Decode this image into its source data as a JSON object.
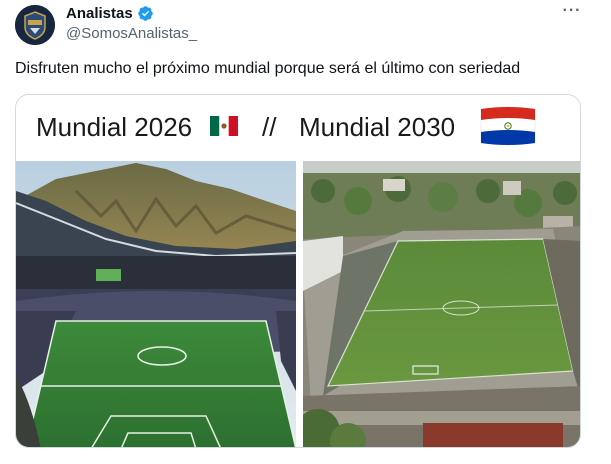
{
  "author": {
    "display_name": "Analistas",
    "handle": "@SomosAnalistas_",
    "verified": true,
    "avatar_icon": "analistas-logo-icon"
  },
  "tweet": {
    "text": "Disfruten mucho el próximo mundial porque será el último con seriedad",
    "more_icon": "more-dots-icon",
    "more_label": "···"
  },
  "media": {
    "left_caption": "Mundial 2026",
    "separator": "//",
    "right_caption": "Mundial 2030",
    "left_flag_icon": "mexico-flag-icon",
    "right_flag_icon": "paraguay-flag-icon"
  },
  "colors": {
    "verified_blue": "#1d9bf0",
    "text_primary": "#0f1419",
    "text_secondary": "#536471"
  }
}
